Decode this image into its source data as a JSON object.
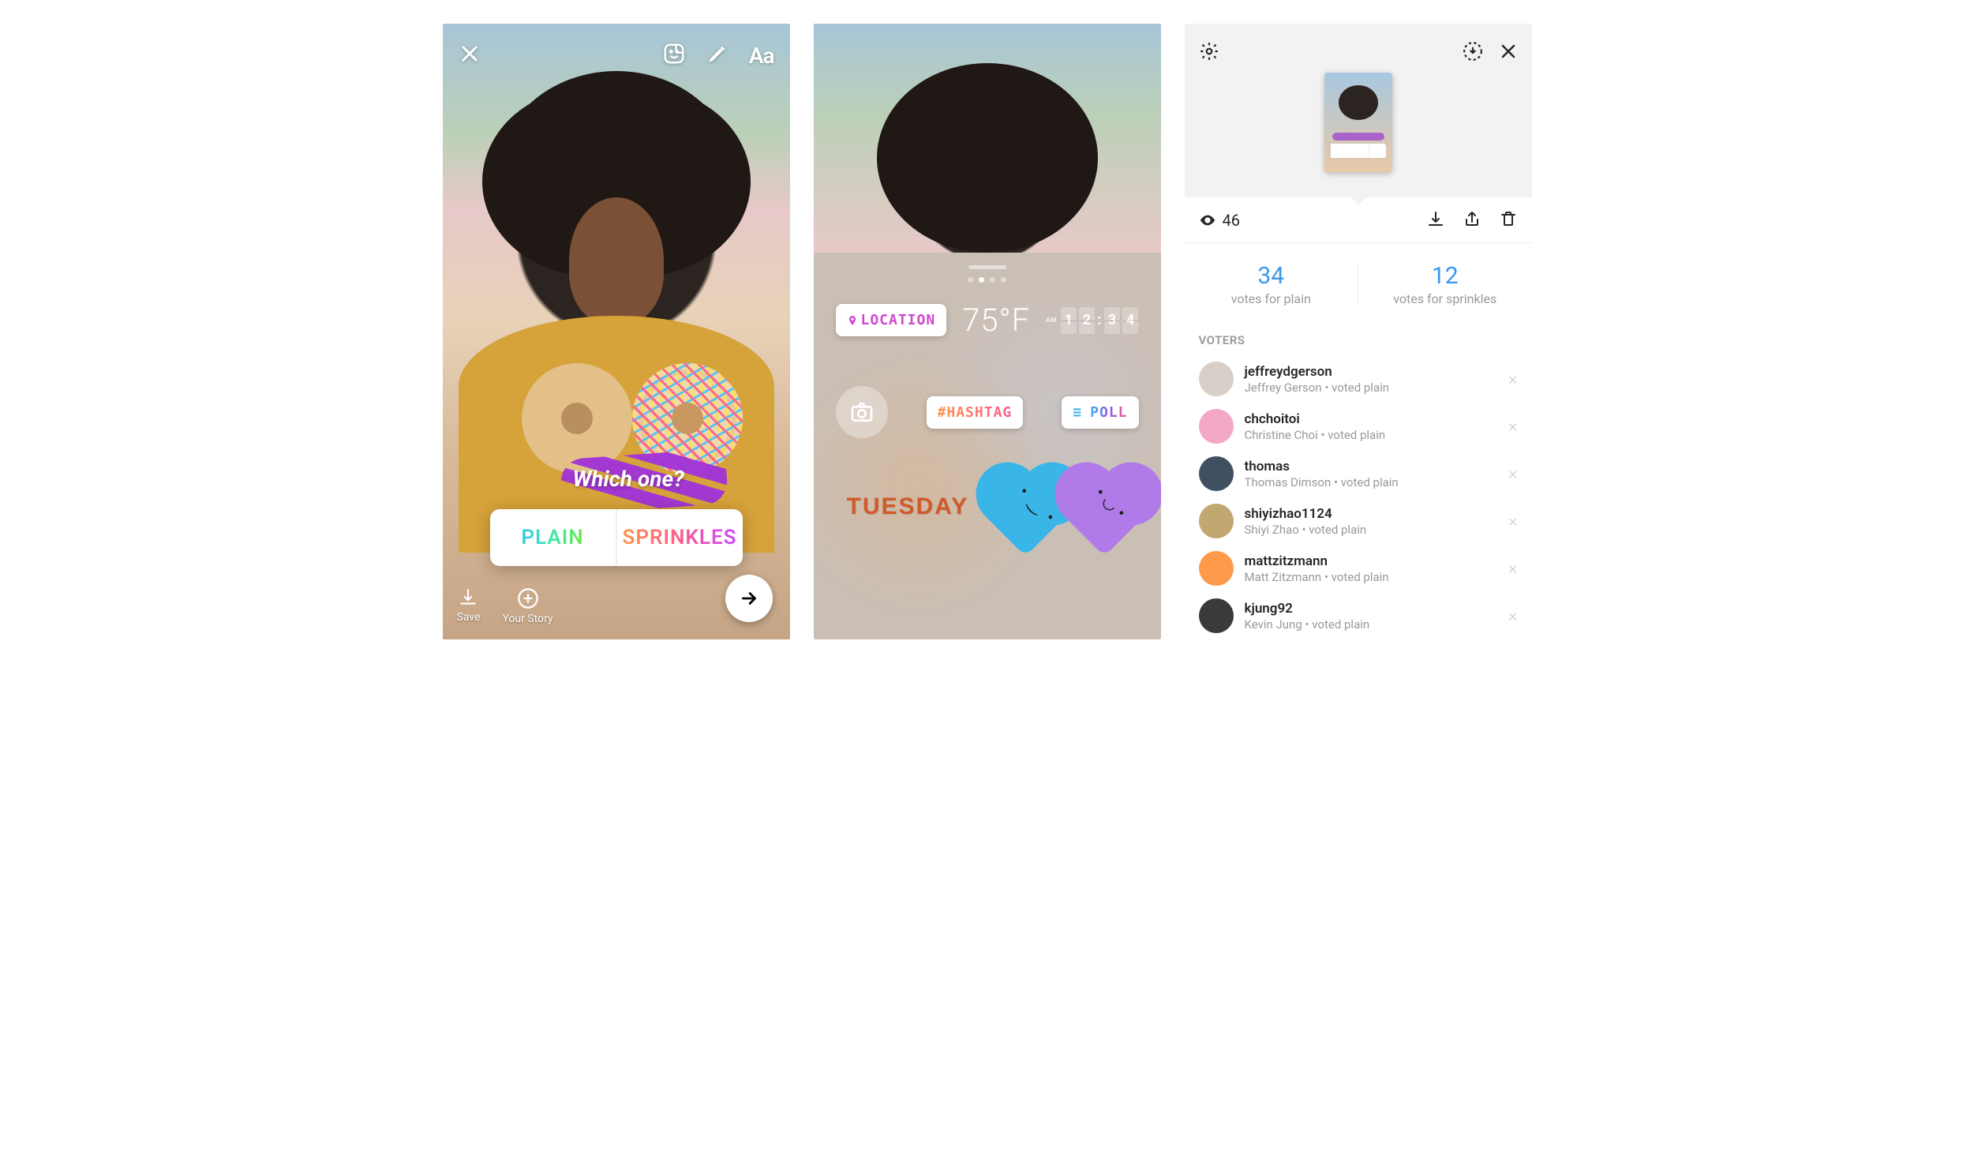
{
  "screen1": {
    "text_tool": "Aa",
    "question": "Which one?",
    "poll": {
      "option_a": "PLAIN",
      "option_b": "SPRINKLES"
    },
    "save_label": "Save",
    "your_story_label": "Your Story"
  },
  "screen2": {
    "location_label": "LOCATION",
    "temperature": "75°F",
    "clock": {
      "period": "AM",
      "d1": "1",
      "d2": "2",
      "d3": "3",
      "d4": "4"
    },
    "hashtag_label": "#HASHTAG",
    "poll_label": "POLL",
    "day_label": "TUESDAY"
  },
  "screen3": {
    "view_count": "46",
    "vote_a_count": "34",
    "vote_a_label": "votes for plain",
    "vote_b_count": "12",
    "vote_b_label": "votes for sprinkles",
    "voters_header": "VOTERS",
    "voters": [
      {
        "username": "jeffreydgerson",
        "name": "Jeffrey Gerson",
        "vote": "voted plain",
        "color": "#d8d0c8"
      },
      {
        "username": "chchoitoi",
        "name": "Christine Choi",
        "vote": "voted plain",
        "color": "#f4a8c8"
      },
      {
        "username": "thomas",
        "name": "Thomas Dimson",
        "vote": "voted plain",
        "color": "#405060"
      },
      {
        "username": "shiyizhao1124",
        "name": "Shiyi Zhao",
        "vote": "voted plain",
        "color": "#c0a870"
      },
      {
        "username": "mattzitzmann",
        "name": "Matt Zitzmann",
        "vote": "voted plain",
        "color": "#ff9a4a"
      },
      {
        "username": "kjung92",
        "name": "Kevin Jung",
        "vote": "voted plain",
        "color": "#3a3a3a"
      }
    ]
  }
}
